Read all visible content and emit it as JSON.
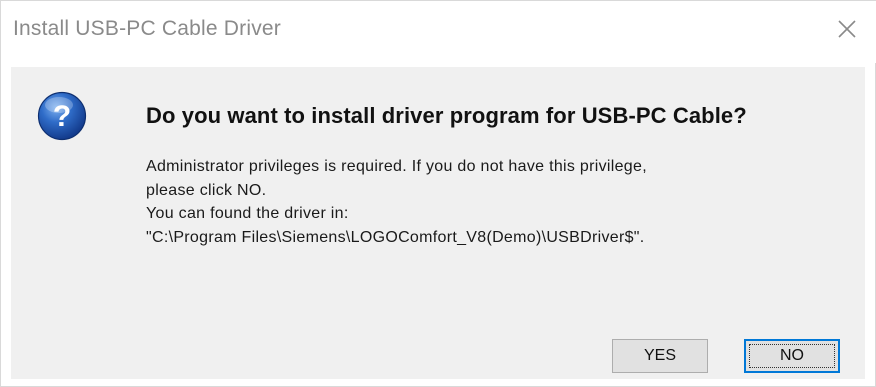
{
  "window": {
    "title": "Install USB-PC Cable Driver",
    "close_icon": "close-x-icon"
  },
  "dialog": {
    "icon": "question-icon",
    "main_instruction": "Do you want to install driver program for USB-PC Cable?",
    "body_lines": [
      "Administrator privileges is required. If you do not have this privilege,",
      "please click NO.",
      "You can found the driver in:",
      "\"C:\\Program Files\\Siemens\\LOGOComfort_V8(Demo)\\USBDriver$\"."
    ]
  },
  "buttons": {
    "yes_label": "YES",
    "no_label": "NO"
  },
  "colors": {
    "title_text": "#8a8a8a",
    "content_bg": "#f0f0f0",
    "button_bg": "#e1e1e1",
    "focus_border": "#0078d7",
    "icon_blue": "#1c4ea3"
  }
}
